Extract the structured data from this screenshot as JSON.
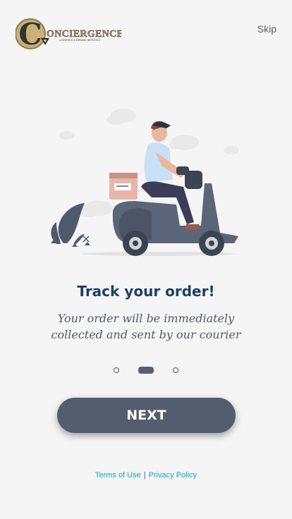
{
  "brand": {
    "logo_letter": "C",
    "logo_name": "ONCIERGENCE",
    "logo_tagline": "LOGISTICS & ERRAND SERVICES"
  },
  "header": {
    "skip_label": "Skip"
  },
  "onboarding": {
    "title": "Track your order!",
    "subtitle": "Your order will be immediately collected and sent by our courier",
    "current_page": 2,
    "total_pages": 3
  },
  "actions": {
    "next_label": "NEXT"
  },
  "footer": {
    "terms_label": "Terms of Use",
    "separator": "|",
    "privacy_label": "Privacy Policy"
  },
  "colors": {
    "background": "#f5f5f5",
    "title": "#1f3f66",
    "button": "#535d6e",
    "link": "#0ea5c8",
    "logo_gold": "#b49a5f"
  }
}
